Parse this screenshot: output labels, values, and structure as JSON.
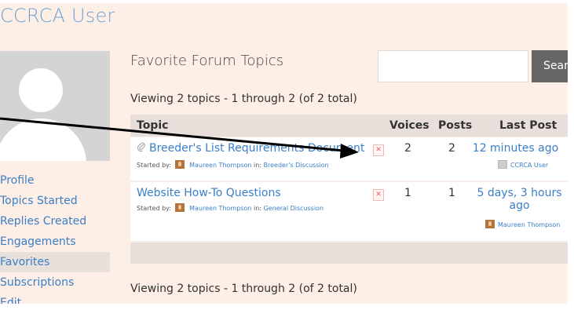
{
  "site": {
    "title": "CCRCA User"
  },
  "sidebar": {
    "items": [
      {
        "label": "Profile"
      },
      {
        "label": "Topics Started"
      },
      {
        "label": "Replies Created"
      },
      {
        "label": "Engagements"
      },
      {
        "label": "Favorites",
        "active": true
      },
      {
        "label": "Subscriptions"
      },
      {
        "label": "Edit"
      }
    ]
  },
  "main": {
    "title": "Favorite Forum Topics",
    "search": {
      "button_label": "Search",
      "value": ""
    },
    "viewing_text": "Viewing 2 topics - 1 through 2 (of 2 total)",
    "table": {
      "headers": {
        "topic": "Topic",
        "voices": "Voices",
        "posts": "Posts",
        "last_post": "Last Post"
      },
      "rows": [
        {
          "title": "Breeder's List Requirements Document",
          "started_by_label": "Started by:",
          "author": "Maureen Thompson",
          "in_label": "in:",
          "forum": "Breeder's Discussion",
          "voices": "2",
          "posts": "2",
          "last_post_time": "12 minutes ago",
          "last_post_user": "CCRCA User",
          "remove_icon": "x-icon"
        },
        {
          "title": "Website How-To Questions",
          "started_by_label": "Started by:",
          "author": "Maureen Thompson",
          "in_label": "in:",
          "forum": "General Discussion",
          "voices": "1",
          "posts": "1",
          "last_post_time": "5 days, 3 hours ago",
          "last_post_user": "Maureen Thompson",
          "remove_icon": "x-icon"
        }
      ]
    }
  },
  "colors": {
    "link": "#3a7fc8",
    "title": "#6fa3d6",
    "background": "#fdeee6",
    "header_bg": "#e8dfda",
    "search_button": "#666666"
  }
}
